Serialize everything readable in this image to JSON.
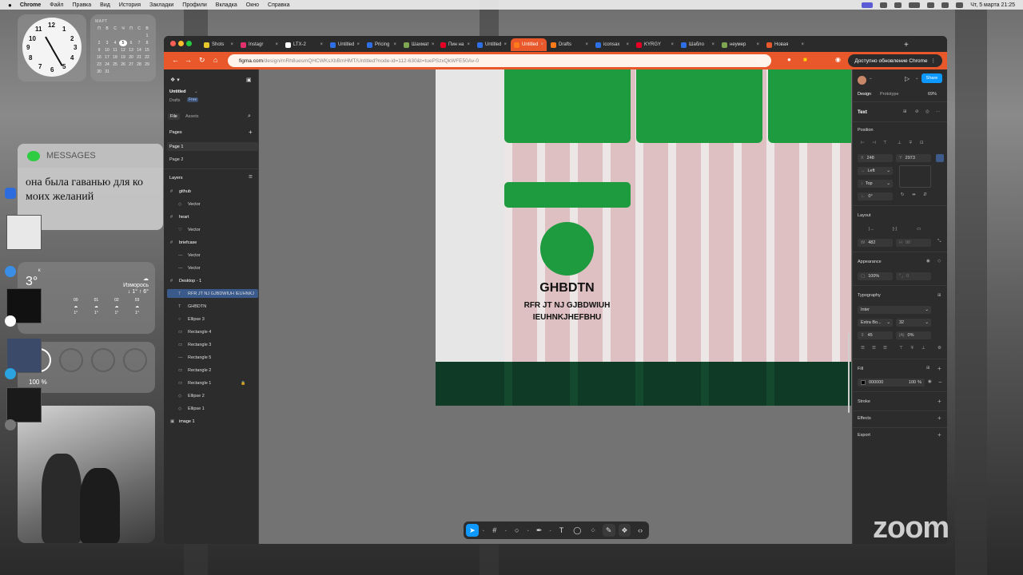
{
  "menubar": {
    "app": "Chrome",
    "items": [
      "Файл",
      "Правка",
      "Вид",
      "История",
      "Закладки",
      "Профили",
      "Вкладка",
      "Окно",
      "Справка"
    ],
    "datetime": "Чт, 5 марта 21:25"
  },
  "widgets": {
    "clock_numbers": [
      "12",
      "1",
      "2",
      "3",
      "4",
      "5",
      "6",
      "7",
      "8",
      "9",
      "10",
      "11"
    ],
    "calendar": {
      "month": "МАРТ",
      "weekdays": [
        "П",
        "В",
        "С",
        "Ч",
        "П",
        "С",
        "В"
      ],
      "days": [
        "",
        "",
        "",
        "",
        "",
        "",
        "1",
        "2",
        "3",
        "4",
        "5",
        "6",
        "7",
        "8",
        "9",
        "10",
        "11",
        "12",
        "13",
        "14",
        "15",
        "16",
        "17",
        "18",
        "19",
        "20",
        "21",
        "22",
        "23",
        "24",
        "25",
        "26",
        "27",
        "28",
        "29",
        "30",
        "31"
      ],
      "today": "5"
    },
    "messages": {
      "title": "MESSAGES",
      "text_line1": "она была гаванью для ко",
      "text_line2": "моих желаний"
    },
    "weather": {
      "city": "к",
      "temp": "3°",
      "condition": "Изморось",
      "range": "↓ 1° ↑ 6°",
      "hours": [
        "00",
        "01",
        "02",
        "03"
      ],
      "hour_temps": [
        "1°",
        "1°",
        "1°",
        "1°"
      ]
    },
    "battery": {
      "percent": "100 %"
    }
  },
  "browser": {
    "tabs": [
      {
        "label": "Shots",
        "color": "#e8c82a"
      },
      {
        "label": "Instagr",
        "color": "#e1306c"
      },
      {
        "label": "LTX-2",
        "color": "#ffffff"
      },
      {
        "label": "Untitled",
        "color": "#2f6fe4"
      },
      {
        "label": "Pricing",
        "color": "#2f6fe4"
      },
      {
        "label": "Шахмат",
        "color": "#7fa650"
      },
      {
        "label": "Пин на",
        "color": "#e60023"
      },
      {
        "label": "Untitled",
        "color": "#2f6fe4"
      },
      {
        "label": "Untitled",
        "color": "#ff7a1a"
      },
      {
        "label": "Drafts",
        "color": "#ff7a1a"
      },
      {
        "label": "iconsax",
        "color": "#2f6fe4"
      },
      {
        "label": "KYRGY",
        "color": "#e60023"
      },
      {
        "label": "Шабло",
        "color": "#2f6fe4"
      },
      {
        "label": "неумер",
        "color": "#7fa650"
      },
      {
        "label": "Новая",
        "color": "#e8582a"
      }
    ],
    "active_tab_index": 8,
    "url_host": "figma.com",
    "url_path": "/design/rnRh8uesmQHCWKsXbBmHMT/Untitled?node-id=112-630&t=tuePSzxQkWFE50Av-0",
    "update_label": "Доступно обновление Chrome"
  },
  "figma": {
    "file_name": "Untitled",
    "drafts": "Drafts",
    "plan": "Free",
    "tabs": {
      "file": "File",
      "assets": "Assets"
    },
    "pages_title": "Pages",
    "pages": [
      "Page 1",
      "Page 2"
    ],
    "layers_title": "Layers",
    "layers": [
      {
        "name": "github",
        "depth": 0,
        "icon": "#"
      },
      {
        "name": "Vector",
        "depth": 1,
        "icon": "◇"
      },
      {
        "name": "heart",
        "depth": 0,
        "icon": "#"
      },
      {
        "name": "Vector",
        "depth": 1,
        "icon": "♡"
      },
      {
        "name": "briefcase",
        "depth": 0,
        "icon": "#"
      },
      {
        "name": "Vector",
        "depth": 1,
        "icon": "—"
      },
      {
        "name": "Vector",
        "depth": 1,
        "icon": "—"
      },
      {
        "name": "Desktop - 1",
        "depth": 0,
        "icon": "#"
      },
      {
        "name": "RFR JT NJ GJBDWIUH IEUHNKJ",
        "depth": 1,
        "icon": "T"
      },
      {
        "name": "GHBDTN",
        "depth": 1,
        "icon": "T"
      },
      {
        "name": "Ellipse 3",
        "depth": 1,
        "icon": "○"
      },
      {
        "name": "Rectangle 4",
        "depth": 1,
        "icon": "▭"
      },
      {
        "name": "Rectangle 3",
        "depth": 1,
        "icon": "▭"
      },
      {
        "name": "Rectangle 5",
        "depth": 1,
        "icon": "—"
      },
      {
        "name": "Rectangle 2",
        "depth": 1,
        "icon": "▭"
      },
      {
        "name": "Rectangle 1",
        "depth": 1,
        "icon": "▭"
      },
      {
        "name": "Ellipse 2",
        "depth": 1,
        "icon": "◇"
      },
      {
        "name": "Ellipse 1",
        "depth": 1,
        "icon": "◇"
      },
      {
        "name": "image 1",
        "depth": 0,
        "icon": "▣"
      }
    ],
    "selected_layer_index": 8,
    "canvas": {
      "heading": "GHBDTN",
      "subtext_line1": "RFR JT NJ GJBDWIUH",
      "subtext_line2": "IEUHNKJHEFBHU"
    },
    "right": {
      "share": "Share",
      "design_tab": "Design",
      "prototype_tab": "Prototype",
      "zoom": "69%",
      "section_text": "Text",
      "position_title": "Position",
      "x": "248",
      "y": "2973",
      "h_constraint": "Left",
      "v_constraint": "Top",
      "rotation": "0°",
      "layout_title": "Layout",
      "w": "482",
      "h": "90",
      "appearance_title": "Appearance",
      "opacity": "100%",
      "radius": "0",
      "typography_title": "Typography",
      "font": "Inter",
      "weight": "Extra Bo...",
      "size": "32",
      "line_height": "45",
      "letter_spacing": "0%",
      "fill_title": "Fill",
      "fill_hex": "000000",
      "fill_opacity": "100",
      "fill_unit": "%",
      "stroke_title": "Stroke",
      "effects_title": "Effects",
      "export_title": "Export"
    }
  },
  "zoom_watermark": "zoom"
}
